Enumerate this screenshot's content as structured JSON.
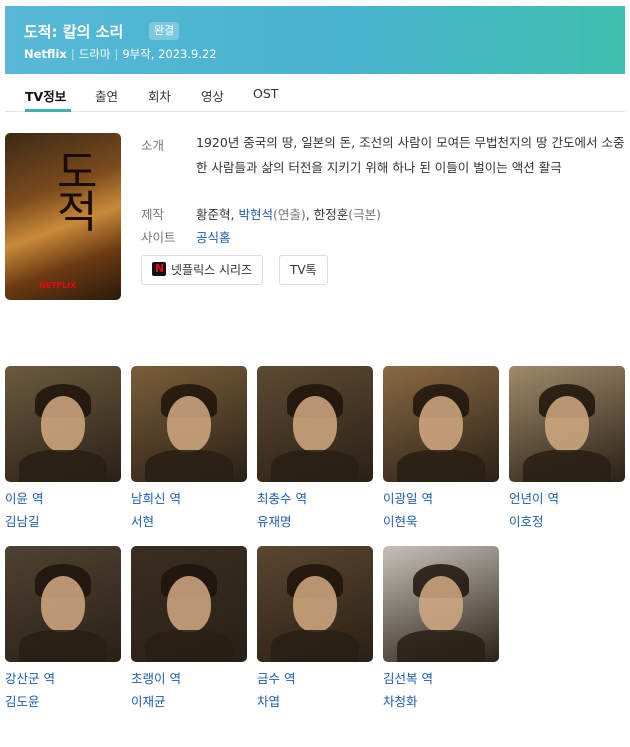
{
  "header": {
    "title": "도적: 칼의 소리",
    "badge": "완결",
    "platform": "Netflix",
    "genre": "드라마",
    "episodes_date": "9부작, 2023.9.22"
  },
  "tabs": [
    "TV정보",
    "출연",
    "회차",
    "영상",
    "OST"
  ],
  "poster": {
    "title_art": "도적",
    "brand": "NETFLIX"
  },
  "info": {
    "synopsis_label": "소개",
    "synopsis": "1920년 중국의 땅, 일본의 돈, 조선의 사람이 모여든 무법천지의 땅 간도에서 소중한 사람들과 삶의 터전을 지키기 위해 하나 된 이들이 벌이는 액션 활극",
    "production_label": "제작",
    "prod_1": "황준혁",
    "prod_2": "박현석",
    "prod_2_role": "(연출)",
    "prod_3": "한정훈",
    "prod_3_role": "(극본)",
    "site_label": "사이트",
    "site_value": "공식홈"
  },
  "chips": {
    "netflix_series": "넷플릭스 시리즈",
    "tv_talk": "TV톡",
    "netflix_icon_letter": "N"
  },
  "cast": [
    {
      "role": "이윤 역",
      "actor": "김남길",
      "bg": "#6b5a3e"
    },
    {
      "role": "남희신 역",
      "actor": "서현",
      "bg": "#7a5e3a"
    },
    {
      "role": "최충수 역",
      "actor": "유재명",
      "bg": "#5e4a32"
    },
    {
      "role": "이광일 역",
      "actor": "이현욱",
      "bg": "#8a6a44"
    },
    {
      "role": "언년이 역",
      "actor": "이호정",
      "bg": "#a08a6a"
    },
    {
      "role": "강산군 역",
      "actor": "김도윤",
      "bg": "#4e4232"
    },
    {
      "role": "초랭이 역",
      "actor": "이재균",
      "bg": "#3a2e22"
    },
    {
      "role": "금수 역",
      "actor": "차엽",
      "bg": "#5a4630"
    },
    {
      "role": "김선복 역",
      "actor": "차청화",
      "bg": "#c7c2b8"
    }
  ]
}
